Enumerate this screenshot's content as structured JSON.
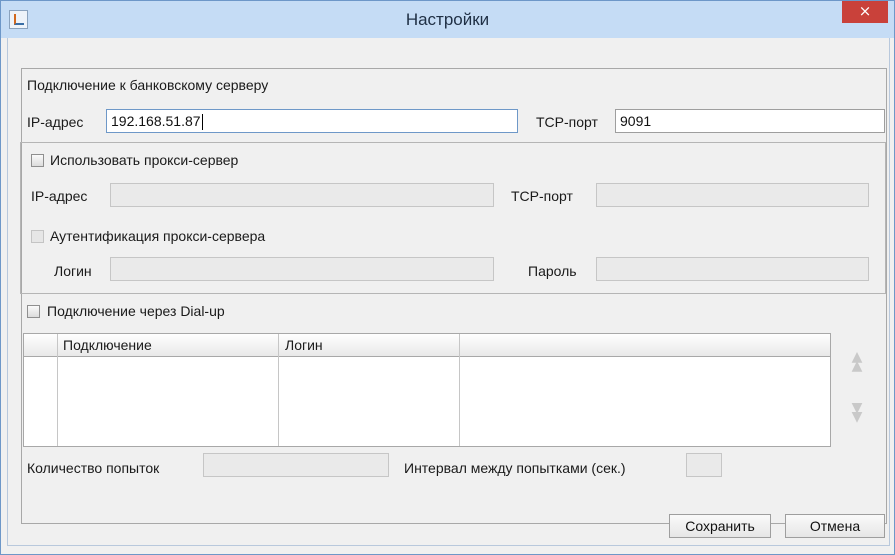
{
  "window": {
    "title": "Настройки",
    "close_icon": "×"
  },
  "bank_server": {
    "section_label": "Подключение к банковскому серверу",
    "ip_label": "IP-адрес",
    "ip_value": "192.168.51.87",
    "tcp_label": "TCP-порт",
    "tcp_value": "9091"
  },
  "proxy": {
    "use_proxy_label": "Использовать прокси-сервер",
    "use_proxy_checked": false,
    "ip_label": "IP-адрес",
    "ip_value": "",
    "tcp_label": "TCP-порт",
    "tcp_value": "",
    "auth_label": "Аутентификация прокси-сервера",
    "auth_checked": false,
    "login_label": "Логин",
    "login_value": "",
    "password_label": "Пароль",
    "password_value": ""
  },
  "dialup": {
    "checkbox_label": "Подключение через Dial-up",
    "checked": false,
    "table": {
      "columns": [
        "",
        "Подключение",
        "Логин",
        ""
      ],
      "rows": []
    },
    "attempts_label": "Количество попыток",
    "attempts_value": "",
    "interval_label": "Интервал между попытками (сек.)",
    "interval_value": ""
  },
  "buttons": {
    "save": "Сохранить",
    "cancel": "Отмена"
  },
  "icons": {
    "app": "java-app-icon",
    "move_up": "double-chevron-up-icon",
    "move_down": "double-chevron-down-icon"
  }
}
